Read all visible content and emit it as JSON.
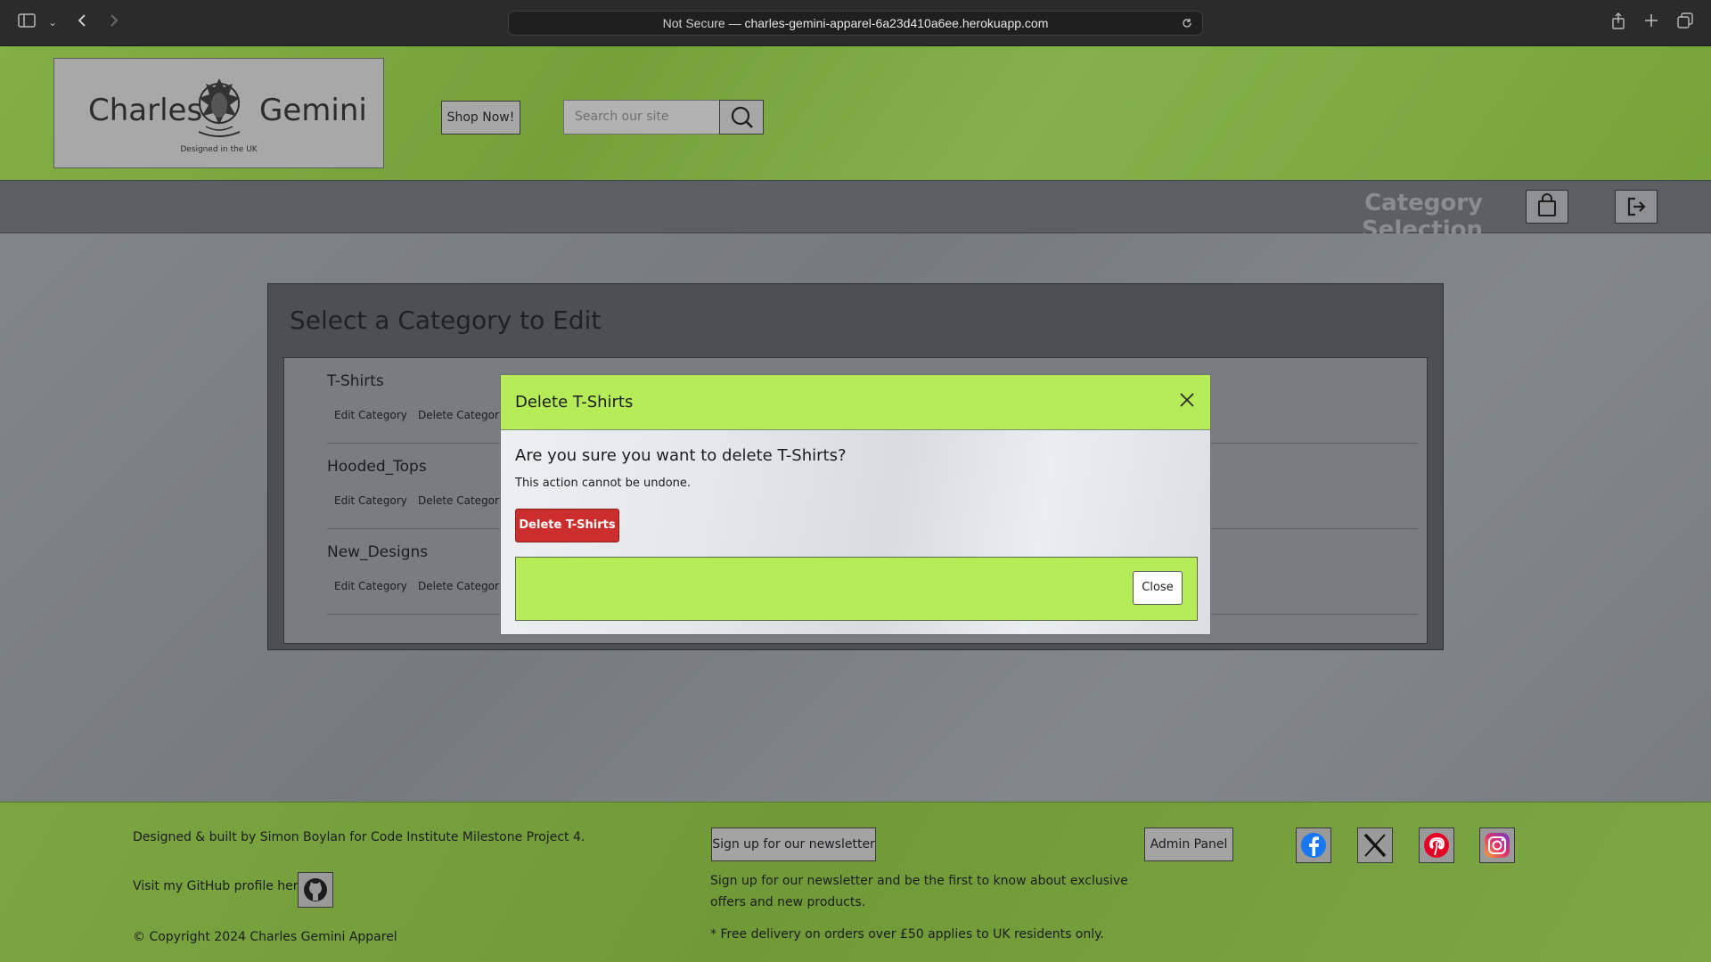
{
  "browser": {
    "url_prefix": "Not Secure —",
    "url": "charles-gemini-apparel-6a23d410a6ee.herokuapp.com"
  },
  "header": {
    "logo_word_left": "Charles",
    "logo_word_right": "Gemini",
    "logo_tagline": "Designed in the UK",
    "shop_label": "Shop Now!",
    "search_placeholder": "Search our site"
  },
  "nav": {
    "title": "Category Selection"
  },
  "panel": {
    "title": "Select a Category to Edit",
    "categories": [
      {
        "name": "T-Shirts",
        "edit": "Edit Category",
        "delete": "Delete Category"
      },
      {
        "name": "Hooded_Tops",
        "edit": "Edit Category",
        "delete": "Delete Category"
      },
      {
        "name": "New_Designs",
        "edit": "Edit Category",
        "delete": "Delete Category"
      }
    ]
  },
  "modal": {
    "title": "Delete T-Shirts",
    "question": "Are you sure you want to delete T-Shirts?",
    "note": "This action cannot be undone.",
    "delete_label": "Delete T-Shirts",
    "close_label": "Close"
  },
  "footer": {
    "credit": "Designed & built by Simon Boylan for Code Institute Milestone Project 4.",
    "github_text": "Visit my GitHub profile here:",
    "copyright": "© Copyright 2024 Charles Gemini Apparel",
    "newsletter_label": "Sign up for our newsletter",
    "newsletter_text": "Sign up for our newsletter and be the first to know about exclusive offers and new products.",
    "delivery_text": "* Free delivery on orders over £50 applies to UK residents only.",
    "admin_label": "Admin Panel"
  },
  "colors": {
    "header_green": "#7bab3c",
    "modal_green": "#b6ec58",
    "danger_red": "#cc2e2e"
  },
  "icons": [
    "sidebar-icon",
    "back-icon",
    "forward-icon",
    "reload-icon",
    "share-icon",
    "new-tab-icon",
    "tabs-icon",
    "search-icon",
    "shopping-bag-icon",
    "logout-icon",
    "close-icon",
    "github-icon",
    "facebook-icon",
    "x-icon",
    "pinterest-icon",
    "instagram-icon"
  ]
}
